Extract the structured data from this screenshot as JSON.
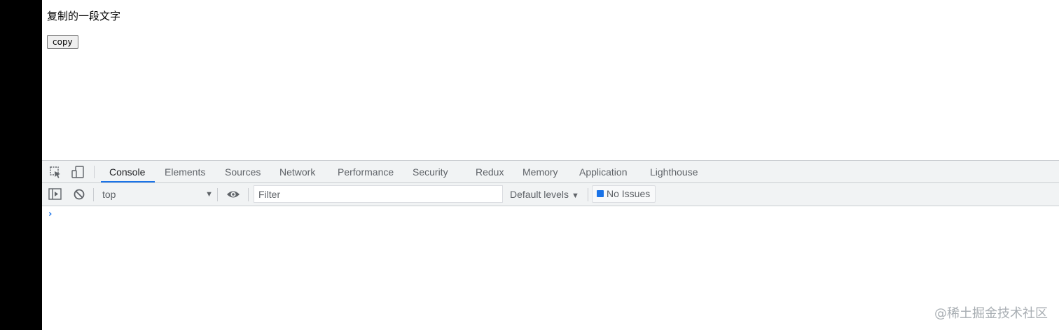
{
  "page": {
    "text": "复制的一段文字",
    "copy_button_label": "copy"
  },
  "devtools": {
    "toolbar_icons": [
      "inspect-element-icon",
      "device-toggle-icon"
    ],
    "tabs": [
      {
        "label": "Console",
        "active": true
      },
      {
        "label": "Elements",
        "active": false
      },
      {
        "label": "Sources",
        "active": false
      },
      {
        "label": "Network",
        "active": false
      },
      {
        "label": "Performance",
        "active": false
      },
      {
        "label": "Security",
        "active": false
      },
      {
        "label": "Redux",
        "active": false
      },
      {
        "label": "Memory",
        "active": false
      },
      {
        "label": "Application",
        "active": false
      },
      {
        "label": "Lighthouse",
        "active": false
      }
    ],
    "filterbar": {
      "context": "top",
      "filter_placeholder": "Filter",
      "levels_label": "Default levels",
      "issues_label": "No Issues"
    },
    "console": {
      "prompt": "›"
    }
  },
  "watermark": "@稀土掘金技术社区",
  "colors": {
    "accent": "#1a73e8",
    "toolbar_bg": "#f1f3f4",
    "border": "#cacdd1",
    "text_muted": "#5f6368"
  }
}
